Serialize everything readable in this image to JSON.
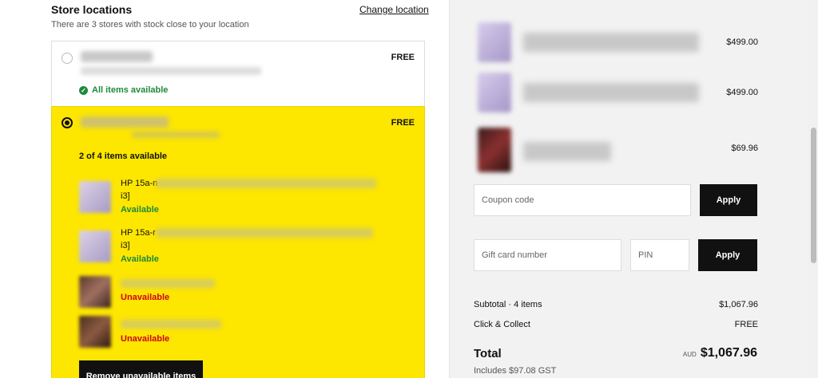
{
  "store_locations": {
    "title": "Store locations",
    "change_link": "Change location",
    "subtitle": "There are 3 stores with stock close to your location",
    "stores": [
      {
        "price": "FREE",
        "status": "All items available",
        "selected": false
      },
      {
        "price": "FREE",
        "selected": true,
        "count": "2 of 4 items available",
        "products": [
          {
            "name_line1": "HP 15a-n",
            "name_line2": "i3]",
            "status": "Available"
          },
          {
            "name_line1": "HP 15a-r",
            "name_line2": "i3]",
            "status": "Available"
          },
          {
            "name_line1": "",
            "name_line2": "",
            "status": "Unavailable"
          },
          {
            "name_line1": "",
            "name_line2": "",
            "status": "Unavailable"
          }
        ],
        "remove_button": "Remove unavailable items"
      }
    ]
  },
  "cart": {
    "items": [
      {
        "price": "$499.00",
        "thumb": "laptop-thumbnail"
      },
      {
        "price": "$499.00",
        "thumb": "laptop-thumbnail"
      },
      {
        "price": "$69.96",
        "thumb": "product-thumbnail"
      }
    ],
    "coupon_placeholder": "Coupon code",
    "coupon_apply": "Apply",
    "gift_card_placeholder": "Gift card number",
    "pin_placeholder": "PIN",
    "gift_apply": "Apply",
    "subtotal_label": "Subtotal · 4 items",
    "subtotal_value": "$1,067.96",
    "click_collect_label": "Click & Collect",
    "click_collect_value": "FREE",
    "total_label": "Total",
    "currency": "AUD",
    "total_value": "$1,067.96",
    "gst_note": "Includes $97.08 GST"
  },
  "colors": {
    "accent_yellow": "#fde600",
    "available_green": "#1e8a3a",
    "unavailable_red": "#d0021b",
    "button_black": "#111111"
  }
}
